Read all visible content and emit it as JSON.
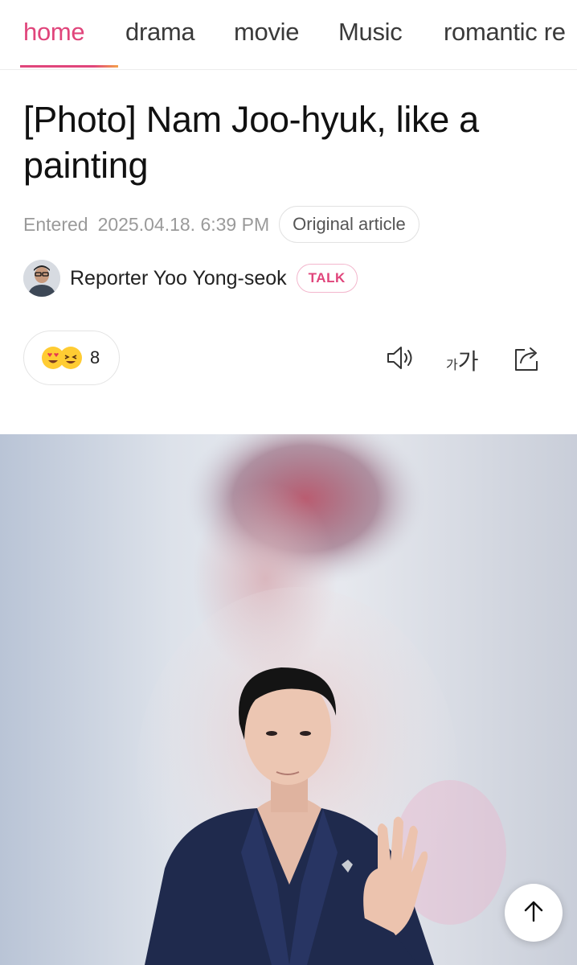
{
  "nav": {
    "items": [
      {
        "label": "home",
        "active": true
      },
      {
        "label": "drama",
        "active": false
      },
      {
        "label": "movie",
        "active": false
      },
      {
        "label": "Music",
        "active": false
      },
      {
        "label": "romantic re",
        "active": false
      }
    ],
    "accent_color": "#e0457b"
  },
  "article": {
    "title": "[Photo] Nam Joo-hyuk, like a painting",
    "entered_label": "Entered",
    "entered_date": "2025.04.18. 6:39 PM",
    "original_article_label": "Original article",
    "reporter": "Reporter Yoo Yong-seok",
    "talk_label": "TALK"
  },
  "actions": {
    "reaction_count": "8",
    "reaction_icons": [
      "heart-eyes-emoji",
      "laughing-emoji"
    ],
    "listen_icon": "speaker-icon",
    "font_size_small": "가",
    "font_size_large": "가",
    "share_icon": "share-icon"
  },
  "photo": {
    "subject": "photo of man in navy suit waving"
  },
  "scroll_top_icon": "arrow-up-icon"
}
